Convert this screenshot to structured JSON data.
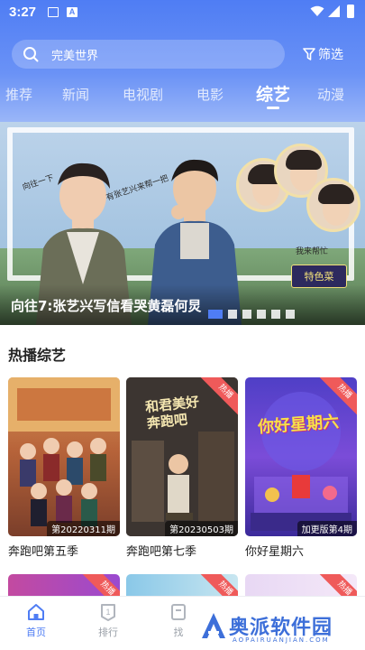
{
  "status_bar": {
    "time": "3:27",
    "icons": [
      "image-icon",
      "a-icon",
      "wifi-icon",
      "signal-icon",
      "battery-icon"
    ]
  },
  "search": {
    "placeholder": "完美世界",
    "filter_label": "筛选"
  },
  "tabs": [
    {
      "label": "推荐",
      "active": false
    },
    {
      "label": "新闻",
      "active": false
    },
    {
      "label": "电视剧",
      "active": false
    },
    {
      "label": "电影",
      "active": false
    },
    {
      "label": "综艺",
      "active": true
    },
    {
      "label": "动漫",
      "active": false
    }
  ],
  "banner": {
    "caption": "向往7:张艺兴写信看哭黄磊何炅",
    "logo_text": "特色菜",
    "note_left": "向往一下",
    "note_right": "有张艺兴来帮一把",
    "note_bubble": "我来帮忙",
    "dot_count": 6,
    "active_dot": 0
  },
  "section": {
    "title": "热播综艺"
  },
  "cards": [
    {
      "title": "奔跑吧第五季",
      "episode": "第20220311期",
      "hot": false
    },
    {
      "title": "奔跑吧第七季",
      "episode": "第20230503期",
      "hot": true,
      "hot_label": "热播",
      "poster_text": "和君美好 奔跑吧"
    },
    {
      "title": "你好星期六",
      "episode": "加更版第4期",
      "hot": true,
      "hot_label": "热播",
      "poster_text": "你好星期六"
    }
  ],
  "next_row_badges": [
    "热播",
    "热播",
    "热播"
  ],
  "bottom_nav": [
    {
      "label": "首页",
      "active": true
    },
    {
      "label": "排行",
      "active": false
    },
    {
      "label": "找",
      "active": false
    }
  ],
  "watermark": {
    "text": "奥派软件园",
    "sub": "AOPAIRUANJIAN.COM"
  },
  "colors": {
    "accent": "#4f7df4",
    "hot_badge": "#ef5a5a"
  }
}
